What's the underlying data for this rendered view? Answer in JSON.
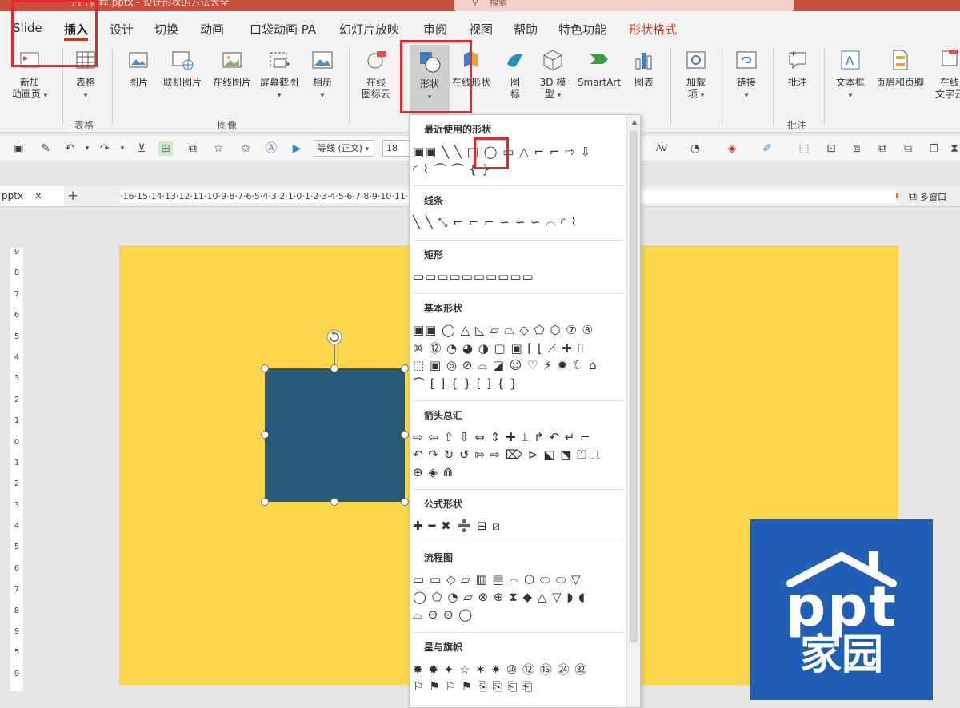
{
  "window": {
    "title": "PPT教程.pptx - 设计形状的方法大全",
    "search_placeholder": "搜索"
  },
  "tabs": [
    {
      "label": "Slide"
    },
    {
      "label": "插入"
    },
    {
      "label": "设计"
    },
    {
      "label": "切换"
    },
    {
      "label": "动画"
    },
    {
      "label": "口袋动画 PA"
    },
    {
      "label": "幻灯片放映"
    },
    {
      "label": "审阅"
    },
    {
      "label": "视图"
    },
    {
      "label": "帮助"
    },
    {
      "label": "特色功能"
    },
    {
      "label": "形状格式"
    }
  ],
  "ribbon": {
    "new_anim_page": {
      "line1": "新加",
      "line2": "动画页"
    },
    "table": "表格",
    "picture": "图片",
    "online_picture": "联机图片",
    "web_picture": "在线图片",
    "screenshot": "屏幕截图",
    "album": "相册",
    "online_icon": {
      "line1": "在线",
      "line2": "图标云"
    },
    "shapes": "形状",
    "online_shapes": "在线形状",
    "icons": {
      "line1": "图",
      "line2": "标"
    },
    "model_3d": {
      "line1": "3D 模",
      "line2": "型"
    },
    "smartart": "SmartArt",
    "chart": "图表",
    "addins": {
      "line1": "加载",
      "line2": "项"
    },
    "link": "链接",
    "comment": "批注",
    "textbox": "文本框",
    "header_footer": "页眉和页脚",
    "online_text": {
      "line1": "在线",
      "line2": "文字云"
    },
    "groups": {
      "tables": "表格",
      "images": "图像",
      "comments": "批注"
    }
  },
  "toolbar": {
    "font_name": "等线 (正文)",
    "font_size": "18"
  },
  "doc": {
    "file_tab": "pptx",
    "close": "×",
    "new_tab": "+",
    "multiwindow": "多窗口"
  },
  "ruler": {
    "h": "·16·15·14·13·12·11·10·9·8·7·6·5·4·3·2·1·0·1·2·3·4·5·6·7·8·9·10·11·12·13·14·15·16·",
    "v": [
      "9",
      "8",
      "7",
      "6",
      "5",
      "4",
      "3",
      "2",
      "1",
      "0",
      "1",
      "2",
      "3",
      "4",
      "5",
      "6",
      "7",
      "8",
      "9",
      "5",
      "9"
    ]
  },
  "dropdown": {
    "recent": "最近使用的形状",
    "lines": "线条",
    "rectangles": "矩形",
    "basic": "基本形状",
    "arrows": "箭头总汇",
    "equation": "公式形状",
    "flowchart": "流程图",
    "stars": "星与旗帜",
    "rows": {
      "recent1": "▣▣ ╲ ╲ □ ◯ ▭ △ ⌐ ⌐ ⇨ ⇩",
      "recent2": "◜ ⌇ ⌒ ⌒ { }",
      "lines": "╲ ╲ ⤡ ⌐ ⌐ ⌐ ∽ ∽ ∽ ⌒ ◜ ⌇",
      "rect": "▭▭▭▭▭▭▭▭▭▭",
      "basic1": "▣▣ ◯ △ ◺ ▱ ⏢ ◇ ⬠ ⬡ ⑦ ⑧",
      "basic2": "⑩ ⑫ ◔ ◕ ◑ ▢ ▣ ⌈ ⌊ ⟋ ✚ ⌷",
      "basic3": "⬚ ▣ ◎ ⊘ ⌓ ◪ ☺ ♡ ⚡ ✹ ☾ ⌂",
      "basic4": "⌒ [ ] { } [ ] { }",
      "arrows1": "⇨ ⇦ ⇧ ⇩ ⇔ ⇕ ✚ ⍊ ↱ ↶ ↵ ⌐",
      "arrows2": "↶ ↷ ↻ ↺ ⇰ ⇨ ⌦ ⊳ ⬕ ⬔ ⏍ ⎍",
      "arrows3": "⊕ ◈ ⋒",
      "equation": "✚ ━ ✖ ➗ ⊟ ⧄",
      "flow1": "▭ ▭ ◇ ▱ ▥ ▤ ⌓ ⬡ ⬭ ⬭ ▽",
      "flow2": "◯ ⬠ ◔ ⏥ ⊗ ⊕ ⧗ ◆ △ ▽ ◗ ◖",
      "flow3": "⌓ ⊖ ⊙ ◯",
      "stars1": "✸ ✹ ✦ ☆ ✶ ✷ ⑩ ⑫ ⑯ ㉔ ㉜",
      "stars2": "⚐ ⚑ ⚐ ⚑ ⎘ ⎘ ⎗ ⎗"
    }
  },
  "logo": {
    "text": "ppt",
    "subtext": "家园"
  },
  "colors": {
    "accent": "#c43e1c",
    "slide_bg": "#fcd74c",
    "shape_fill": "#255b79",
    "logo_bg": "#1f5fb5",
    "annotation": "#e5282d"
  }
}
